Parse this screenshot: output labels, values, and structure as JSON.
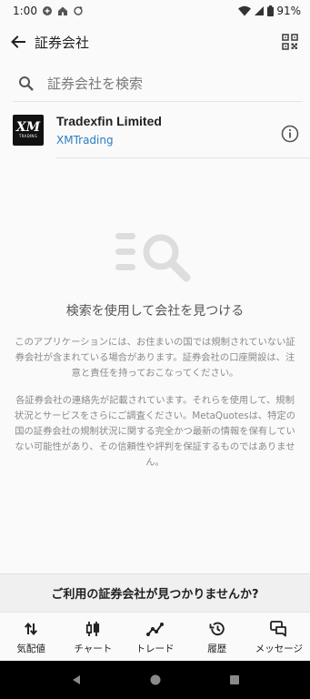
{
  "status_bar": {
    "time": "1:00",
    "battery": "91%"
  },
  "app_bar": {
    "title": "証券会社"
  },
  "search": {
    "placeholder": "証券会社を検索"
  },
  "broker": {
    "name": "Tradexfin Limited",
    "server": "XMTrading",
    "logo_text": "XM",
    "logo_subtext": "TRADING"
  },
  "empty_state": {
    "title": "検索を使用して会社を見つける",
    "paragraph1": "このアプリケーションには、お住まいの国では規制されていない証券会社が含まれている場合があります。証券会社の口座開設は、注意と責任を持っておこなってください。",
    "paragraph2": "各証券会社の連絡先が記載されています。それらを使用して、規制状況とサービスをさらにご調査ください。MetaQuotesは、特定の国の証券会社の規制状況に関する完全かつ最新の情報を保有していない可能性があり、その信頼性や評判を保証するものではありません。"
  },
  "not_found": {
    "label": "ご利用の証券会社が見つかりませんか?"
  },
  "bottom_nav": {
    "items": [
      {
        "label": "気配値",
        "icon": "quotes-arrows-icon"
      },
      {
        "label": "チャート",
        "icon": "candlestick-chart-icon"
      },
      {
        "label": "トレード",
        "icon": "trade-line-icon"
      },
      {
        "label": "履歴",
        "icon": "history-icon"
      },
      {
        "label": "メッセージ",
        "icon": "messages-icon"
      }
    ]
  },
  "colors": {
    "accent_link": "#2b7cc4",
    "text_primary": "#202124",
    "text_secondary": "#8a8a8a",
    "illustration": "#dddddd"
  }
}
